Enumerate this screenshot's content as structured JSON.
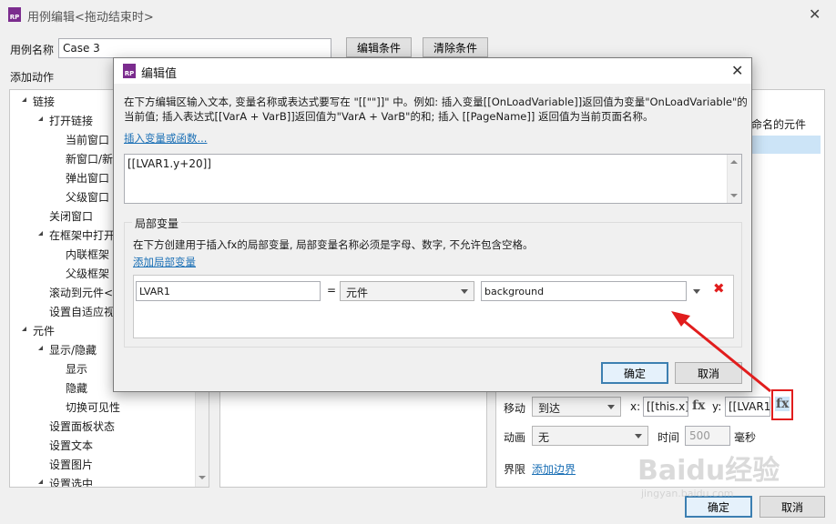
{
  "main": {
    "window_title": "用例编辑<拖动结束时>",
    "case_name_label": "用例名称",
    "case_name_value": "Case 3",
    "edit_condition_label": "编辑条件",
    "clear_condition_label": "清除条件",
    "add_action_label": "添加动作",
    "configure_hint": "未命名的元件",
    "tree": [
      "链接",
      "打开链接",
      "当前窗口",
      "新窗口/新标",
      "弹出窗口",
      "父级窗口",
      "关闭窗口",
      "在框架中打开链",
      "内联框架",
      "父级框架",
      "滚动到元件<锚",
      "设置自适应视图",
      "元件",
      "显示/隐藏",
      "显示",
      "隐藏",
      "切换可见性",
      "设置面板状态",
      "设置文本",
      "设置图片",
      "设置选中"
    ],
    "move_label": "移动",
    "move_type": "到达",
    "x_label": "x:",
    "x_value": "[[this.x]]",
    "y_label": "y:",
    "y_value": "[[LVAR1.",
    "fx_label": "fx",
    "anim_label": "动画",
    "anim_value": "无",
    "time_label": "时间",
    "time_value": "500",
    "ms_label": "毫秒",
    "bound_label": "界限",
    "add_bound_link": "添加边界",
    "ok_label": "确定",
    "cancel_label": "取消"
  },
  "dialog": {
    "title": "编辑值",
    "description_line1": "在下方编辑区输入文本, 变量名称或表达式要写在 \"[[\"\"]]\" 中。例如: 插入变量[[OnLoadVariable]]返回值为变量\"OnLoadVariable\"的",
    "description_line2": "当前值; 插入表达式[[VarA + VarB]]返回值为\"VarA + VarB\"的和; 插入 [[PageName]] 返回值为当前页面名称。",
    "insert_link": "插入变量或函数...",
    "expression": "[[LVAR1.y+20]]",
    "local_vars_title": "局部变量",
    "local_vars_desc": "在下方创建用于插入fx的局部变量, 局部变量名称必须是字母、数字, 不允许包含空格。",
    "add_local_var_link": "添加局部变量",
    "var_name": "LVAR1",
    "equals": "=",
    "var_type": "元件",
    "var_target": "background",
    "ok_label": "确定",
    "cancel_label": "取消"
  },
  "watermark": {
    "text": "Baidu经验",
    "url": "jingyan.baidu.com"
  },
  "colors": {
    "accent_red": "#e11d1d",
    "link_blue": "#1a6fb5",
    "logo_purple": "#7b2c8e"
  }
}
